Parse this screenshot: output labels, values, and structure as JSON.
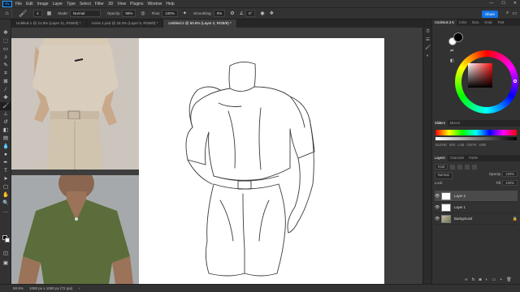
{
  "menu": {
    "logo": "Ps",
    "items": [
      "File",
      "Edit",
      "Image",
      "Layer",
      "Type",
      "Select",
      "Filter",
      "3D",
      "View",
      "Plugins",
      "Window",
      "Help"
    ]
  },
  "options": {
    "brush_size": "4",
    "mode_label": "Mode:",
    "mode_value": "Normal",
    "opacity_label": "Opacity:",
    "opacity_value": "99%",
    "flow_label": "Flow:",
    "flow_value": "100%",
    "smoothing_label": "Smoothing:",
    "smoothing_value": "0%",
    "angle_value": "0°",
    "share_label": "Share"
  },
  "tabs": [
    {
      "label": "Untitled-1 @ 21.8% (Layer 11, RGB/8) *"
    },
    {
      "label": "Annie 1.psd @ 33.3% (Layer 5, RGB/8) *"
    },
    {
      "label": "Untitled-2 @ 50.6% (Layer 2, RGB/8) *"
    }
  ],
  "status": {
    "zoom": "50.6%",
    "doc_size": "1080 px x 1080 px (72 ppi)"
  },
  "color_panel": {
    "tabs": [
      "Coolorus 2.5",
      "Color",
      "Swa.",
      "Grad.",
      "Patt."
    ],
    "fg_color": "#000000",
    "bg_color": "#ffffff"
  },
  "adjust_panel": {
    "tabs": [
      "Sliders",
      "Mixers"
    ],
    "labels": [
      "BLEND",
      "MIX",
      "LAB",
      "CMYK",
      "HSB"
    ]
  },
  "layers_panel": {
    "tabs": [
      "Layers",
      "Channels",
      "Paths"
    ],
    "kind_label": "Kind",
    "blend_mode": "Normal",
    "opacity_label": "Opacity:",
    "opacity_value": "100%",
    "lock_label": "Lock:",
    "fill_label": "Fill:",
    "fill_value": "100%",
    "layers": [
      {
        "name": "Layer 2",
        "active": true,
        "thumb": "white"
      },
      {
        "name": "Layer 1",
        "active": false,
        "thumb": "white"
      },
      {
        "name": "Background",
        "active": false,
        "thumb": "photo"
      }
    ]
  }
}
